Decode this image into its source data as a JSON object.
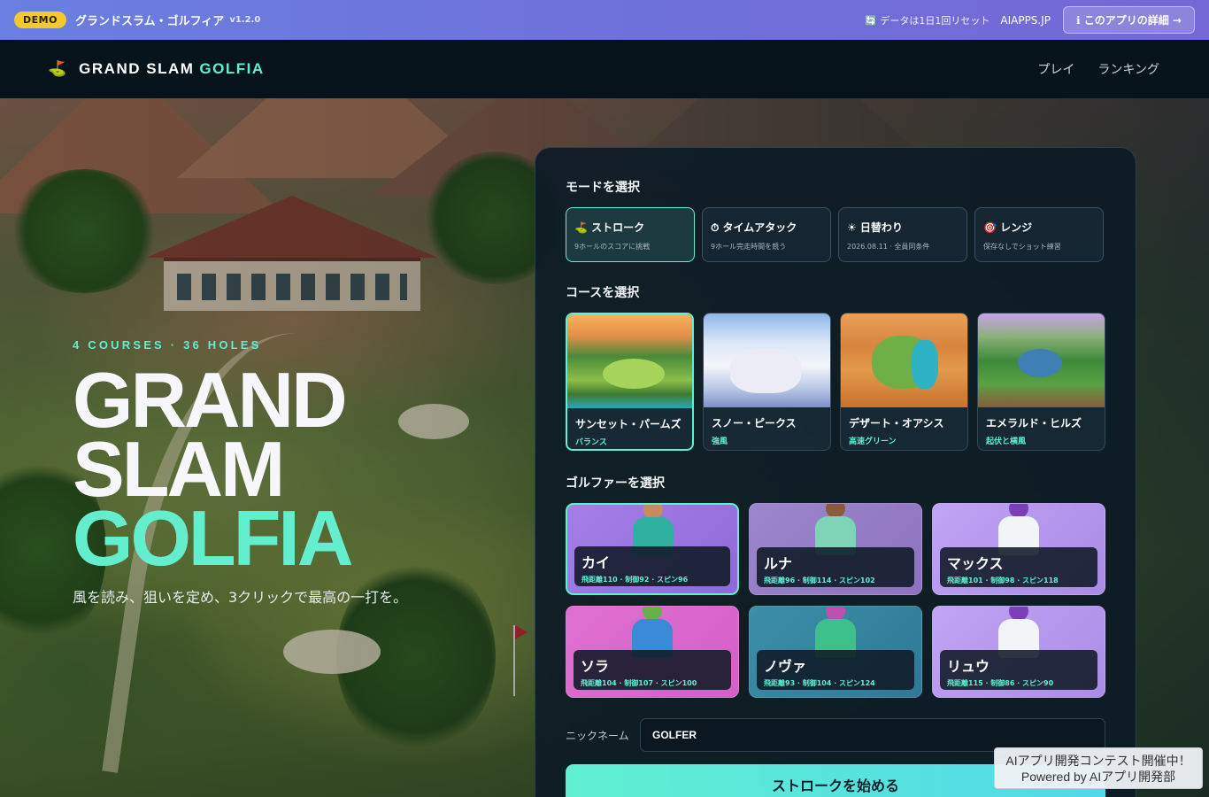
{
  "demo_bar": {
    "badge": "DEMO",
    "title": "グランドスラム・ゴルフィア",
    "version": "v1.2.0",
    "reset_notice": "🔄 データは1日1回リセット",
    "site_link": "AIAPPS.JP",
    "detail_button": "ℹ このアプリの詳細 →"
  },
  "header": {
    "logo_icon": "⛳",
    "logo_main": "GRAND SLAM",
    "logo_accent": "GOLFIA",
    "nav": [
      "プレイ",
      "ランキング"
    ]
  },
  "hero": {
    "kicker": "4 COURSES · 36 HOLES",
    "title_line1": "GRAND",
    "title_line2": "SLAM",
    "title_line3": "GOLFIA",
    "subtitle": "風を読み、狙いを定め、3クリックで最高の一打を。"
  },
  "mode_section": {
    "title": "モードを選択",
    "modes": [
      {
        "name": "⛳ ストローク",
        "desc": "9ホールのスコアに挑戦",
        "selected": true
      },
      {
        "name": "⏱ タイムアタック",
        "desc": "9ホール完走時間を競う",
        "selected": false
      },
      {
        "name": "☀ 日替わり",
        "desc": "2026.08.11 · 全員同条件",
        "selected": false
      },
      {
        "name": "🎯 レンジ",
        "desc": "保存なしでショット練習",
        "selected": false
      }
    ]
  },
  "course_section": {
    "title": "コースを選択",
    "courses": [
      {
        "name": "サンセット・パームズ",
        "tag": "バランス",
        "selected": true
      },
      {
        "name": "スノー・ピークス",
        "tag": "強風",
        "selected": false
      },
      {
        "name": "デザート・オアシス",
        "tag": "高速グリーン",
        "selected": false
      },
      {
        "name": "エメラルド・ヒルズ",
        "tag": "起伏と横風",
        "selected": false
      }
    ]
  },
  "golfer_section": {
    "title": "ゴルファーを選択",
    "golfers": [
      {
        "name": "カイ",
        "stats": "飛距離110 · 制御92 · スピン96",
        "selected": true
      },
      {
        "name": "ルナ",
        "stats": "飛距離96 · 制御114 · スピン102",
        "selected": false
      },
      {
        "name": "マックス",
        "stats": "飛距離101 · 制御98 · スピン118",
        "selected": false
      },
      {
        "name": "ソラ",
        "stats": "飛距離104 · 制御107 · スピン100",
        "selected": false
      },
      {
        "name": "ノヴァ",
        "stats": "飛距離93 · 制御104 · スピン124",
        "selected": false
      },
      {
        "name": "リュウ",
        "stats": "飛距離115 · 制御86 · スピン90",
        "selected": false
      }
    ]
  },
  "nickname": {
    "label": "ニックネーム",
    "value": "GOLFER"
  },
  "start_button": "ストロークを始める",
  "promo": {
    "line1": "AIアプリ開発コンテスト開催中！",
    "line2": "Powered by AIアプリ開発部"
  },
  "colors": {
    "accent": "#5ef0cf",
    "demo_bar": "#6a7fe0",
    "badge": "#f5c82f",
    "panel": "#0d1b26"
  }
}
